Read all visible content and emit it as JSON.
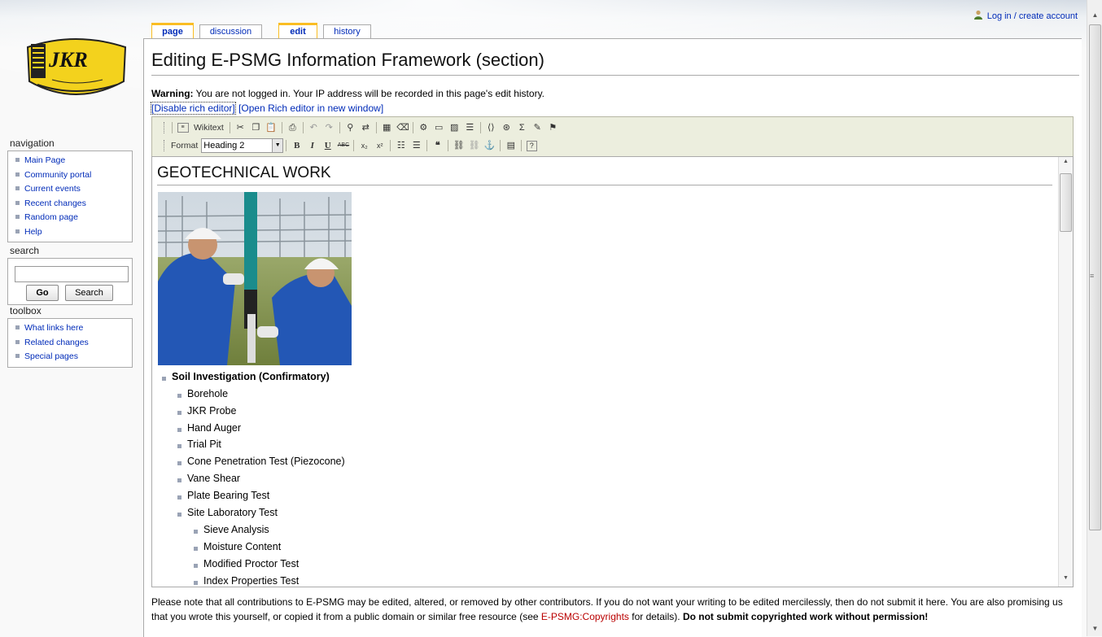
{
  "personal": {
    "login_label": "Log in / create account"
  },
  "logo": {
    "text": "JKR"
  },
  "tabs": [
    {
      "label": "page"
    },
    {
      "label": "discussion"
    },
    {
      "label": "edit"
    },
    {
      "label": "history"
    }
  ],
  "navigation": {
    "title": "navigation",
    "items": [
      {
        "label": "Main Page"
      },
      {
        "label": "Community portal"
      },
      {
        "label": "Current events"
      },
      {
        "label": "Recent changes"
      },
      {
        "label": "Random page"
      },
      {
        "label": "Help"
      }
    ]
  },
  "search": {
    "title": "search",
    "input_value": "",
    "go_label": "Go",
    "search_label": "Search"
  },
  "toolbox": {
    "title": "toolbox",
    "items": [
      {
        "label": "What links here"
      },
      {
        "label": "Related changes"
      },
      {
        "label": "Special pages"
      }
    ]
  },
  "content": {
    "heading": "Editing E-PSMG Information Framework (section)",
    "warning_bold": "Warning:",
    "warning_text": " You are not logged in. Your IP address will be recorded in this page's edit history.",
    "disable_rich_editor": "[Disable rich editor]",
    "open_rich_editor": "[Open Rich editor in new window]"
  },
  "toolbar": {
    "wikitext_label": "Wikitext",
    "format_label": "Format",
    "format_value": "Heading 2"
  },
  "editor": {
    "heading": "GEOTECHNICAL WORK",
    "items": [
      {
        "label": "Soil Investigation (Confirmatory)",
        "level": 1,
        "bold": true
      },
      {
        "label": "Borehole",
        "level": 2
      },
      {
        "label": "JKR Probe",
        "level": 2
      },
      {
        "label": "Hand Auger",
        "level": 2
      },
      {
        "label": "Trial Pit",
        "level": 2
      },
      {
        "label": "Cone Penetration Test (Piezocone)",
        "level": 2
      },
      {
        "label": "Vane Shear",
        "level": 2
      },
      {
        "label": "Plate Bearing Test",
        "level": 2
      },
      {
        "label": "Site Laboratory Test",
        "level": 2
      },
      {
        "label": "Sieve Analysis",
        "level": 3
      },
      {
        "label": "Moisture Content",
        "level": 3
      },
      {
        "label": "Modified Proctor Test",
        "level": 3
      },
      {
        "label": "Index Properties Test",
        "level": 3
      }
    ]
  },
  "footer": {
    "line1": "Please note that all contributions to E-PSMG may be edited, altered, or removed by other contributors. If you do not want your writing to be edited mercilessly, then do not submit it here.",
    "line2_a": "You are also promising us that you wrote this yourself, or copied it from a public domain or similar free resource (see ",
    "copyright_link": "E-PSMG:Copyrights",
    "line2_b": " for details). ",
    "line2_bold": "Do not submit copyrighted work without permission!"
  }
}
